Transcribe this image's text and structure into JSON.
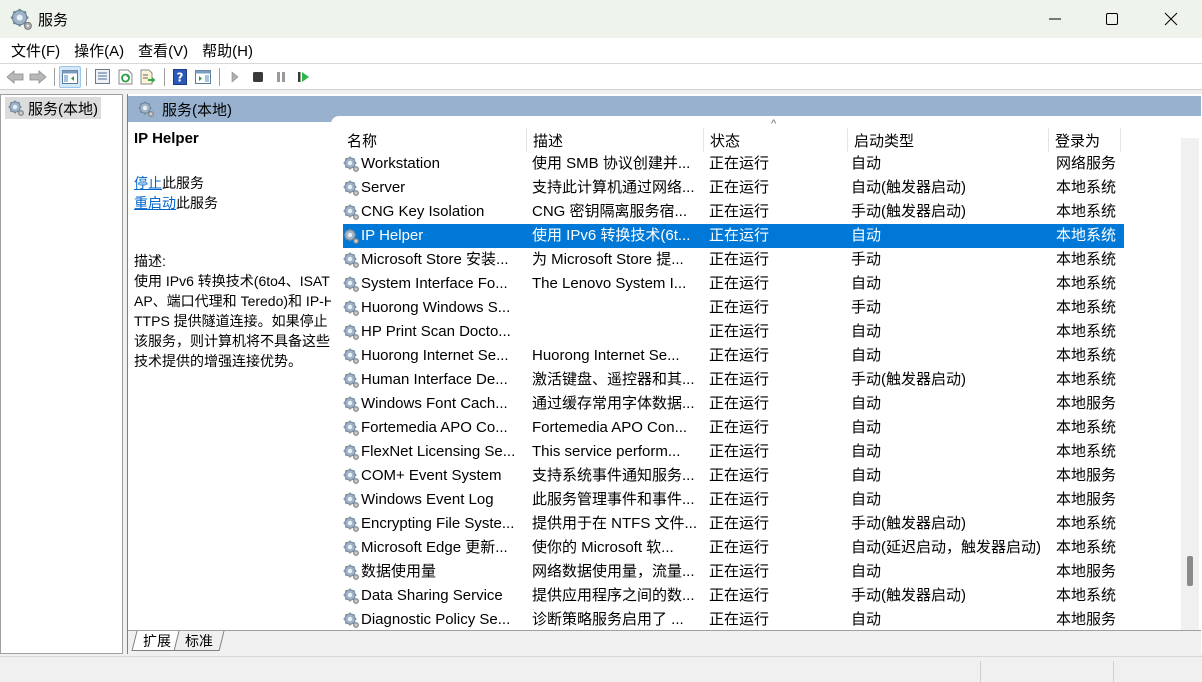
{
  "window": {
    "title": "服务",
    "icon": "services-gear-icon",
    "controls": [
      "minimize",
      "maximize",
      "close"
    ]
  },
  "menu": [
    "文件(F)",
    "操作(A)",
    "查看(V)",
    "帮助(H)"
  ],
  "toolbar": {
    "buttons": [
      "back",
      "forward",
      "show-hide-console-tree",
      "properties",
      "refresh",
      "export-list",
      "help",
      "show-hide-action-pane",
      "start-service",
      "stop-service",
      "pause-service",
      "resume-service"
    ]
  },
  "tree": {
    "root_label": "服务(本地)"
  },
  "content": {
    "header_label": "服务(本地)",
    "selected_service": {
      "name": "IP Helper",
      "stop_link": "停止",
      "stop_suffix": "此服务",
      "restart_link": "重启动",
      "restart_suffix": "此服务",
      "desc_label": "描述:",
      "description": "使用 IPv6 转换技术(6to4、ISATAP、端口代理和 Teredo)和 IP-HTTPS 提供隧道连接。如果停止该服务，则计算机将不具备这些技术提供的增强连接优势。"
    },
    "columns": [
      "名称",
      "描述",
      "状态",
      "启动类型",
      "登录为"
    ],
    "sort_indicator": "^",
    "rows": [
      {
        "name": "Workstation",
        "desc": "使用 SMB 协议创建并...",
        "status": "正在运行",
        "startup": "自动",
        "logon": "网络服务"
      },
      {
        "name": "Server",
        "desc": "支持此计算机通过网络...",
        "status": "正在运行",
        "startup": "自动(触发器启动)",
        "logon": "本地系统"
      },
      {
        "name": "CNG Key Isolation",
        "desc": "CNG 密钥隔离服务宿...",
        "status": "正在运行",
        "startup": "手动(触发器启动)",
        "logon": "本地系统"
      },
      {
        "name": "IP Helper",
        "desc": "使用 IPv6 转换技术(6t...",
        "status": "正在运行",
        "startup": "自动",
        "logon": "本地系统",
        "selected": true
      },
      {
        "name": "Microsoft Store 安装...",
        "desc": "为 Microsoft Store 提...",
        "status": "正在运行",
        "startup": "手动",
        "logon": "本地系统"
      },
      {
        "name": "System Interface Fo...",
        "desc": "The Lenovo System I...",
        "status": "正在运行",
        "startup": "自动",
        "logon": "本地系统"
      },
      {
        "name": "Huorong Windows S...",
        "desc": "",
        "status": "正在运行",
        "startup": "手动",
        "logon": "本地系统"
      },
      {
        "name": "HP Print Scan Docto...",
        "desc": "",
        "status": "正在运行",
        "startup": "自动",
        "logon": "本地系统"
      },
      {
        "name": "Huorong Internet Se...",
        "desc": "Huorong Internet Se...",
        "status": "正在运行",
        "startup": "自动",
        "logon": "本地系统"
      },
      {
        "name": "Human Interface De...",
        "desc": "激活键盘、遥控器和其...",
        "status": "正在运行",
        "startup": "手动(触发器启动)",
        "logon": "本地系统"
      },
      {
        "name": "Windows Font Cach...",
        "desc": "通过缓存常用字体数据...",
        "status": "正在运行",
        "startup": "自动",
        "logon": "本地服务"
      },
      {
        "name": "Fortemedia APO Co...",
        "desc": "Fortemedia APO Con...",
        "status": "正在运行",
        "startup": "自动",
        "logon": "本地系统"
      },
      {
        "name": "FlexNet Licensing Se...",
        "desc": "This service perform...",
        "status": "正在运行",
        "startup": "自动",
        "logon": "本地系统"
      },
      {
        "name": "COM+ Event System",
        "desc": "支持系统事件通知服务...",
        "status": "正在运行",
        "startup": "自动",
        "logon": "本地服务"
      },
      {
        "name": "Windows Event Log",
        "desc": "此服务管理事件和事件...",
        "status": "正在运行",
        "startup": "自动",
        "logon": "本地服务"
      },
      {
        "name": "Encrypting File Syste...",
        "desc": "提供用于在 NTFS 文件...",
        "status": "正在运行",
        "startup": "手动(触发器启动)",
        "logon": "本地系统"
      },
      {
        "name": " Microsoft Edge 更新...",
        "desc": "使你的 Microsoft 软...",
        "status": "正在运行",
        "startup": "自动(延迟启动，触发器启动)",
        "logon": "本地系统"
      },
      {
        "name": "数据使用量",
        "desc": "网络数据使用量，流量...",
        "status": "正在运行",
        "startup": "自动",
        "logon": "本地服务"
      },
      {
        "name": "Data Sharing Service",
        "desc": "提供应用程序之间的数...",
        "status": "正在运行",
        "startup": "手动(触发器启动)",
        "logon": "本地系统"
      },
      {
        "name": "Diagnostic Policy Se...",
        "desc": "诊断策略服务启用了 ...",
        "status": "正在运行",
        "startup": "自动",
        "logon": "本地服务"
      }
    ],
    "tabs": [
      "扩展",
      "标准"
    ],
    "active_tab": "扩展"
  },
  "colors": {
    "selection": "#0078d7",
    "header_band": "#97b1cf",
    "link": "#0066cc",
    "titlebar": "#eef3ec"
  }
}
